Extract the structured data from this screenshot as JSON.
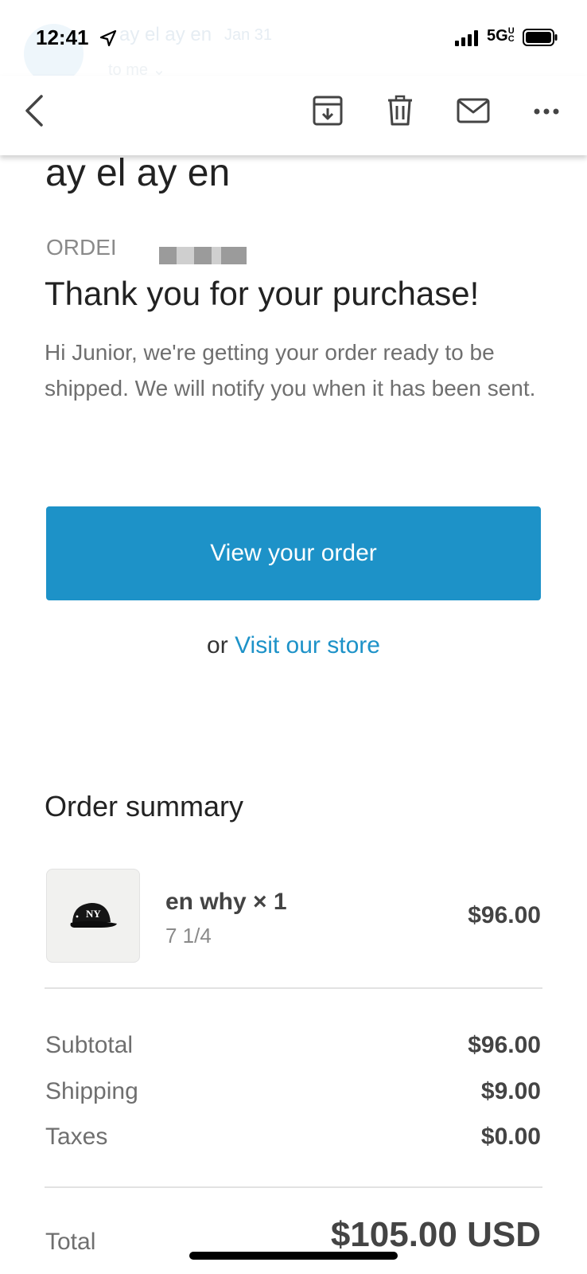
{
  "status": {
    "time": "12:41",
    "carrier": "5G",
    "carrier_suffix": "UC"
  },
  "ghost_header": {
    "sender": "ay el ay en",
    "date": "Jan 31",
    "to": "to me ⌄"
  },
  "toolbar": {
    "back_icon": "chevron-left-icon",
    "archive_icon": "archive-icon",
    "delete_icon": "trash-icon",
    "mail_icon": "mail-icon",
    "more_icon": "more-horizontal-icon"
  },
  "email": {
    "subject": "ay el ay en",
    "order_label": "ORDEI",
    "heading": "Thank you for your purchase!",
    "message": "Hi Junior, we're getting your order ready to be shipped. We will notify you when it has been sent.",
    "cta_label": "View your order",
    "or_text": "or",
    "store_link": "Visit our store"
  },
  "summary": {
    "title": "Order summary",
    "item": {
      "name": "en why × 1",
      "variant": "7 1/4",
      "price": "$96.00",
      "thumb_icon": "cap-icon"
    },
    "rows": [
      {
        "label": "Subtotal",
        "value": "$96.00"
      },
      {
        "label": "Shipping",
        "value": "$9.00"
      },
      {
        "label": "Taxes",
        "value": "$0.00"
      }
    ],
    "total_label": "Total",
    "total_value": "$105.00 USD"
  },
  "colors": {
    "accent": "#1d92c8",
    "text": "#222222",
    "muted": "#6f6f6f"
  }
}
